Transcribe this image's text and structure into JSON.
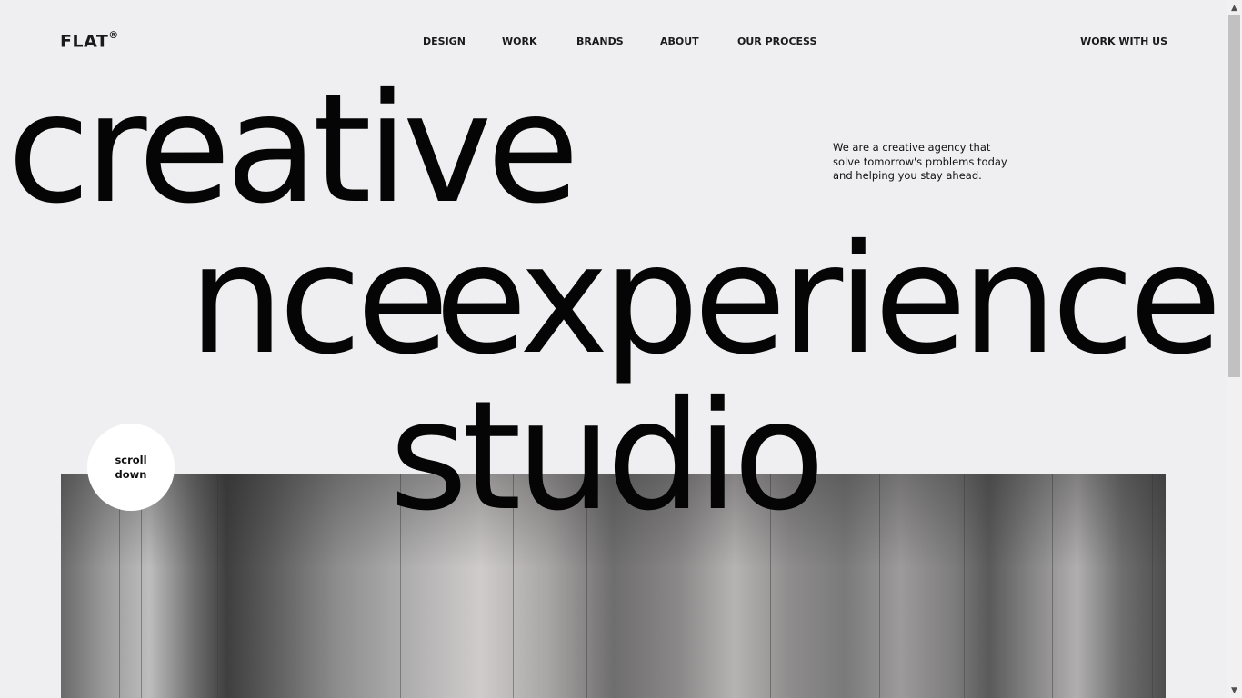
{
  "header": {
    "logo": "FLAT",
    "logo_mark": "®",
    "nav": [
      {
        "label": "DESIGN"
      },
      {
        "label": "WORK"
      },
      {
        "label": "BRANDS"
      },
      {
        "label": "ABOUT"
      },
      {
        "label": "OUR PROCESS"
      }
    ],
    "cta": "WORK WITH US"
  },
  "hero": {
    "word_1": "creative",
    "word_2_left": "experience",
    "word_2": "experience",
    "word_3": "studio",
    "tagline_lines": [
      "We are a creative agency that",
      "solve tomorrow's problems today",
      "and helping you stay ahead."
    ]
  },
  "scroll_badge": {
    "line_1": "scroll",
    "line_2": "down"
  },
  "scrollbar": {
    "up_icon": "chevron-up-icon",
    "down_icon": "chevron-down-icon"
  },
  "colors": {
    "background": "#efeff1",
    "text": "#0a0a0a",
    "badge": "#ffffff"
  }
}
